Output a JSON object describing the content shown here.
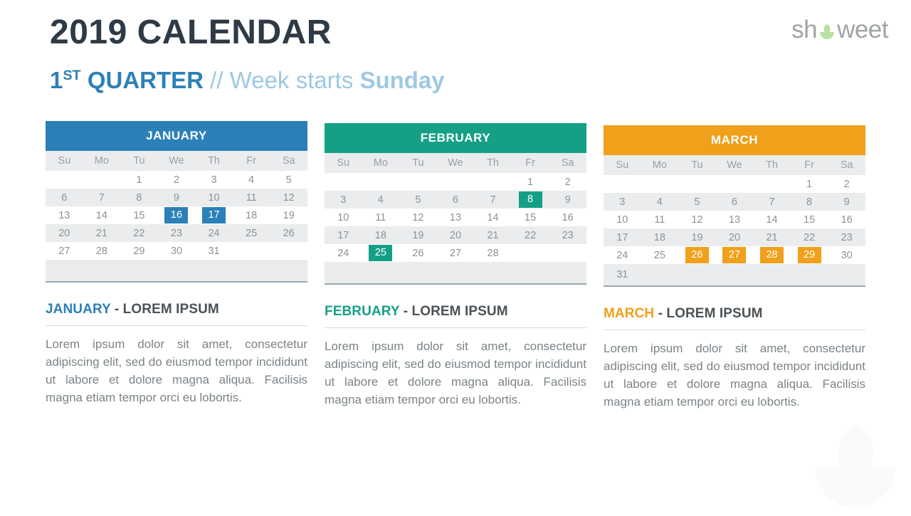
{
  "brand": {
    "logo_prefix": "sh",
    "logo_suffix": "weet",
    "logo_icon": "leaf-icon",
    "logo_color": "#a0a4a6",
    "leaf_color": "#b9dfa1"
  },
  "header": {
    "title": "2019 CALENDAR",
    "quarter": "1",
    "quarter_ordinal": "ST",
    "quarter_word": "QUARTER",
    "separator": "//",
    "week_starts_label": "Week starts",
    "week_start_day": "Sunday",
    "title_color": "#2e3b47",
    "accent_color": "#2c80b8",
    "muted_accent_color": "#9ec8e4"
  },
  "weekdays": [
    "Su",
    "Mo",
    "Tu",
    "We",
    "Th",
    "Fr",
    "Sa"
  ],
  "months": [
    {
      "name": "JANUARY",
      "color": "#2c80b8",
      "weeks": [
        [
          "",
          "",
          "1",
          "2",
          "3",
          "4",
          "5"
        ],
        [
          "6",
          "7",
          "8",
          "9",
          "10",
          "11",
          "12"
        ],
        [
          "13",
          "14",
          "15",
          "16",
          "17",
          "18",
          "19"
        ],
        [
          "20",
          "21",
          "22",
          "23",
          "24",
          "25",
          "26"
        ],
        [
          "27",
          "28",
          "29",
          "30",
          "31",
          "",
          ""
        ],
        [
          "",
          "",
          "",
          "",
          "",
          "",
          ""
        ]
      ],
      "highlights": [
        "16",
        "17"
      ],
      "section_title_month": "JANUARY",
      "section_title_rest": " - LOREM IPSUM",
      "body": "Lorem ipsum dolor sit amet, consectetur adipiscing elit, sed do eiusmod tempor incididunt ut labore et dolore magna aliqua. Facilisis magna etiam tempor orci eu lobortis."
    },
    {
      "name": "FEBRUARY",
      "color": "#15a085",
      "weeks": [
        [
          "",
          "",
          "",
          "",
          "",
          "1",
          "2"
        ],
        [
          "3",
          "4",
          "5",
          "6",
          "7",
          "8",
          "9"
        ],
        [
          "10",
          "11",
          "12",
          "13",
          "14",
          "15",
          "16"
        ],
        [
          "17",
          "18",
          "19",
          "20",
          "21",
          "22",
          "23"
        ],
        [
          "24",
          "25",
          "26",
          "27",
          "28",
          "",
          ""
        ],
        [
          "",
          "",
          "",
          "",
          "",
          "",
          ""
        ]
      ],
      "highlights": [
        "8",
        "25"
      ],
      "section_title_month": "FEBRUARY",
      "section_title_rest": " - LOREM IPSUM",
      "body": "Lorem ipsum dolor sit amet, consectetur adipiscing elit, sed do eiusmod tempor incididunt ut labore et dolore magna aliqua. Facilisis magna etiam tempor orci eu lobortis."
    },
    {
      "name": "MARCH",
      "color": "#f0a01a",
      "weeks": [
        [
          "",
          "",
          "",
          "",
          "",
          "1",
          "2"
        ],
        [
          "3",
          "4",
          "5",
          "6",
          "7",
          "8",
          "9"
        ],
        [
          "10",
          "11",
          "12",
          "13",
          "14",
          "15",
          "16"
        ],
        [
          "17",
          "18",
          "19",
          "20",
          "21",
          "22",
          "23"
        ],
        [
          "24",
          "25",
          "26",
          "27",
          "28",
          "29",
          "30"
        ],
        [
          "31",
          "",
          "",
          "",
          "",
          "",
          ""
        ]
      ],
      "highlights": [
        "26",
        "27",
        "28",
        "29"
      ],
      "section_title_month": "MARCH",
      "section_title_rest": " - LOREM IPSUM",
      "body": "Lorem ipsum dolor sit amet, consectetur adipiscing elit, sed do eiusmod tempor incididunt ut labore et dolore magna aliqua. Facilisis magna etiam tempor orci eu lobortis."
    }
  ]
}
